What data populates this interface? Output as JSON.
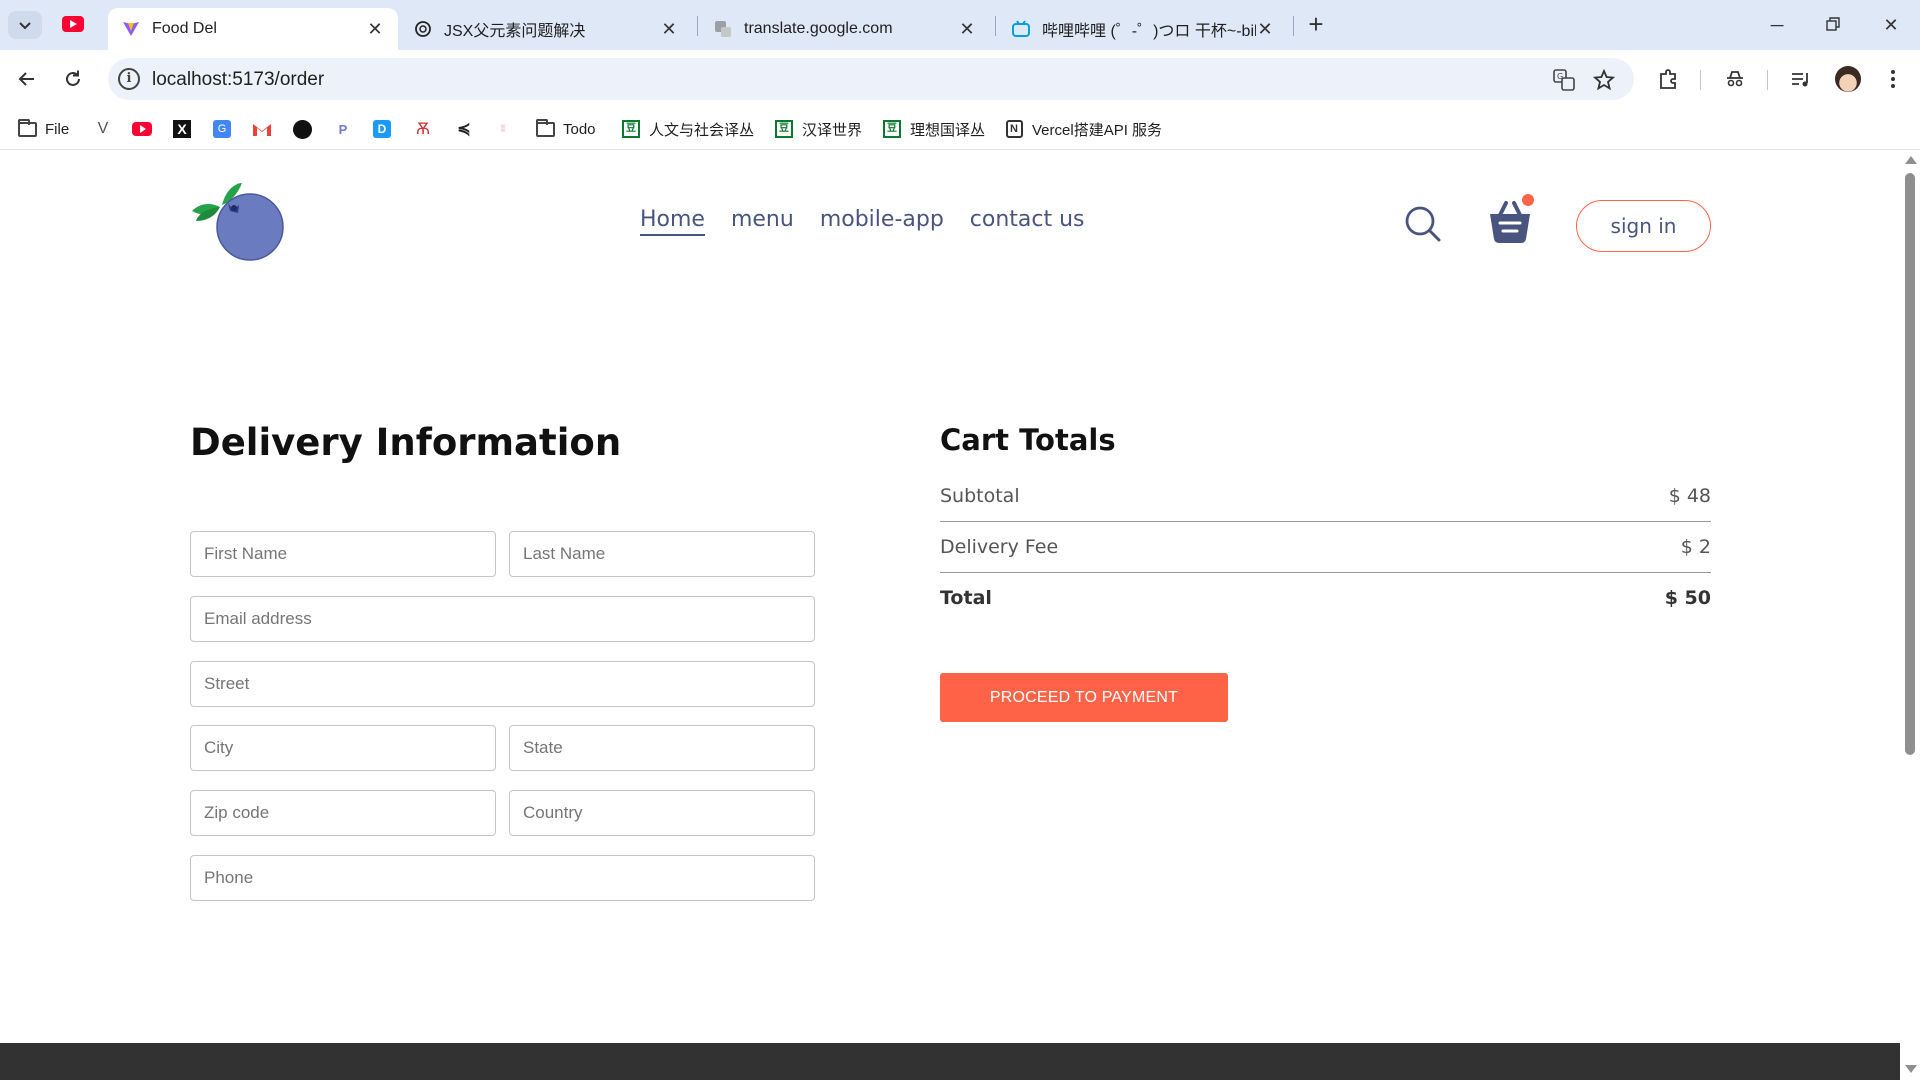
{
  "browser": {
    "tabs": [
      {
        "title": "Food Del",
        "active": true
      },
      {
        "title": "JSX父元素问题解决",
        "active": false
      },
      {
        "title": "translate.google.com",
        "active": false
      },
      {
        "title": "哔哩哔哩 (゜-゜)つロ 干杯~-bilibili",
        "active": false
      }
    ],
    "url": "localhost:5173/order",
    "bookmarks": [
      {
        "label": "File",
        "icon": "folder-icon"
      },
      {
        "label": "",
        "icon": "v-icon"
      },
      {
        "label": "",
        "icon": "youtube-icon"
      },
      {
        "label": "",
        "icon": "x-icon"
      },
      {
        "label": "",
        "icon": "google-translate-icon"
      },
      {
        "label": "",
        "icon": "gmail-icon"
      },
      {
        "label": "",
        "icon": "github-icon"
      },
      {
        "label": "",
        "icon": "p-icon"
      },
      {
        "label": "",
        "icon": "d-icon"
      },
      {
        "label": "",
        "icon": "tower-icon"
      },
      {
        "label": "",
        "icon": "bird-icon"
      },
      {
        "label": "",
        "icon": "faint-icon"
      },
      {
        "label": "Todo",
        "icon": "folder-icon"
      },
      {
        "label": "人文与社会译丛",
        "icon": "douban-icon"
      },
      {
        "label": "汉译世界",
        "icon": "douban-icon"
      },
      {
        "label": "理想国译丛",
        "icon": "douban-icon"
      },
      {
        "label": "Vercel搭建API 服务",
        "icon": "notion-icon"
      }
    ]
  },
  "site": {
    "nav": [
      {
        "label": "Home",
        "active": true
      },
      {
        "label": "menu",
        "active": false
      },
      {
        "label": "mobile-app",
        "active": false
      },
      {
        "label": "contact us",
        "active": false
      }
    ],
    "signin_label": "sign in",
    "accent": "#ff6347",
    "nav_color": "#49557e"
  },
  "delivery": {
    "title": "Delivery Information",
    "placeholders": {
      "first_name": "First Name",
      "last_name": "Last Name",
      "email": "Email address",
      "street": "Street",
      "city": "City",
      "state": "State",
      "zip": "Zip code",
      "country": "Country",
      "phone": "Phone"
    }
  },
  "cart": {
    "title": "Cart Totals",
    "subtotal_label": "Subtotal",
    "subtotal_value": "$ 48",
    "delivery_label": "Delivery Fee",
    "delivery_value": "$ 2",
    "total_label": "Total",
    "total_value": "$ 50",
    "button_label": "PROCEED TO PAYMENT"
  }
}
